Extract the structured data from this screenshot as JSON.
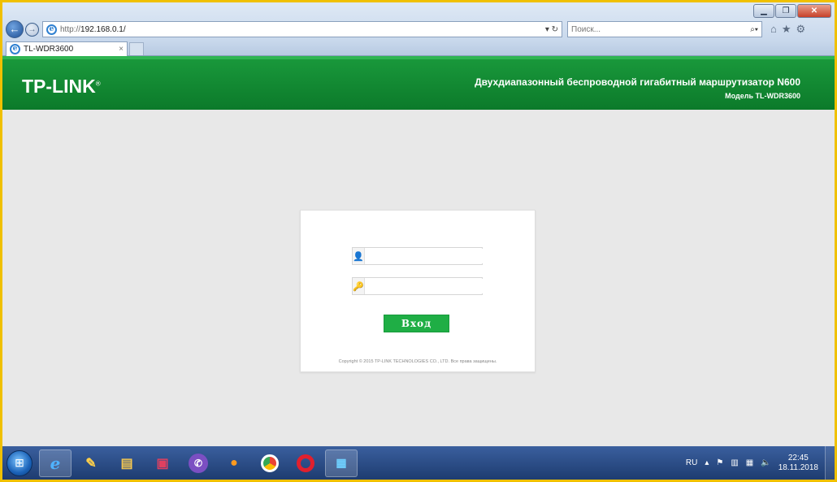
{
  "browser": {
    "address_url_prefix": "http://",
    "address_url_host": "192.168.0.1/",
    "address_controls": "▾ ↻",
    "search_placeholder": "Поиск...",
    "search_icon": "search-icon",
    "right_icons": [
      "home-icon",
      "star-icon",
      "gear-icon"
    ],
    "tab_title": "TL-WDR3600",
    "tab_close": "×",
    "window_controls": [
      "minimize",
      "maximize",
      "close"
    ]
  },
  "router": {
    "logo": "TP-LINK",
    "logo_mark": "®",
    "title": "Двухдиапазонный беспроводной гигабитный маршрутизатор N600",
    "model": "Модель TL-WDR3600",
    "login": {
      "username_value": "",
      "password_value": "",
      "username_icon": "user-icon",
      "password_icon": "key-icon",
      "button_label": "Вход"
    },
    "copyright": "Copyright © 2015 TP-LINK TECHNOLOGIES CO., LTD. Все права защищены."
  },
  "taskbar": {
    "items": [
      "internet-explorer",
      "paint",
      "file-explorer",
      "save",
      "viber",
      "firefox",
      "chrome",
      "opera",
      "remote-desktop"
    ],
    "lang": "RU",
    "clock_time": "22:45",
    "clock_date": "18.11.2018"
  },
  "colors": {
    "tp_green": "#0c7a2a",
    "button_green": "#1fae45",
    "frame_yellow": "#f0c000"
  }
}
